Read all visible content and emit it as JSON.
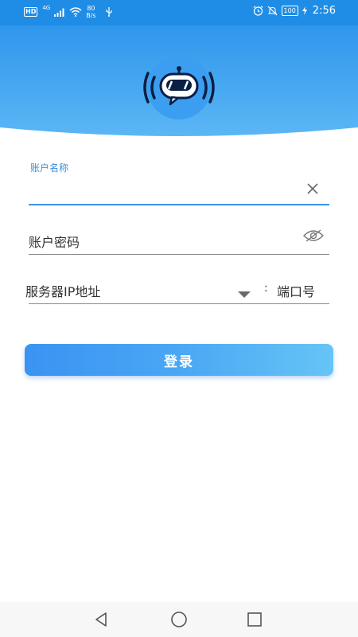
{
  "status_bar": {
    "hd_badge": "HD",
    "network_gen": "4G",
    "net_speed_value": "80",
    "net_speed_unit": "B/s",
    "battery": "100",
    "time": "2:56"
  },
  "login_form": {
    "account_name_label": "账户名称",
    "account_name_value": "",
    "password_placeholder": "账户密码",
    "server_ip_placeholder": "服务器IP地址",
    "port_separator": ":",
    "port_placeholder": "端口号",
    "login_button_label": "登录"
  },
  "colors": {
    "status_bar_bg": "#1f8de6",
    "header_gradient_top": "#2f97ec",
    "header_gradient_bottom": "#5bb6f5",
    "accent": "#3d93e3",
    "button_gradient_start": "#3a93f2",
    "button_gradient_end": "#66c4f6"
  },
  "icons": {
    "status_bar": [
      "hd-icon",
      "signal-icon",
      "wifi-icon",
      "usb-icon",
      "alarm-icon",
      "mute-icon",
      "battery-icon",
      "charging-icon"
    ],
    "logo": "robot-chat-logo",
    "account_field": "clear-icon",
    "password_field": "eye-hidden-icon",
    "server_field": "dropdown-icon",
    "nav_bar": [
      "back-icon",
      "home-icon",
      "recent-apps-icon"
    ]
  }
}
